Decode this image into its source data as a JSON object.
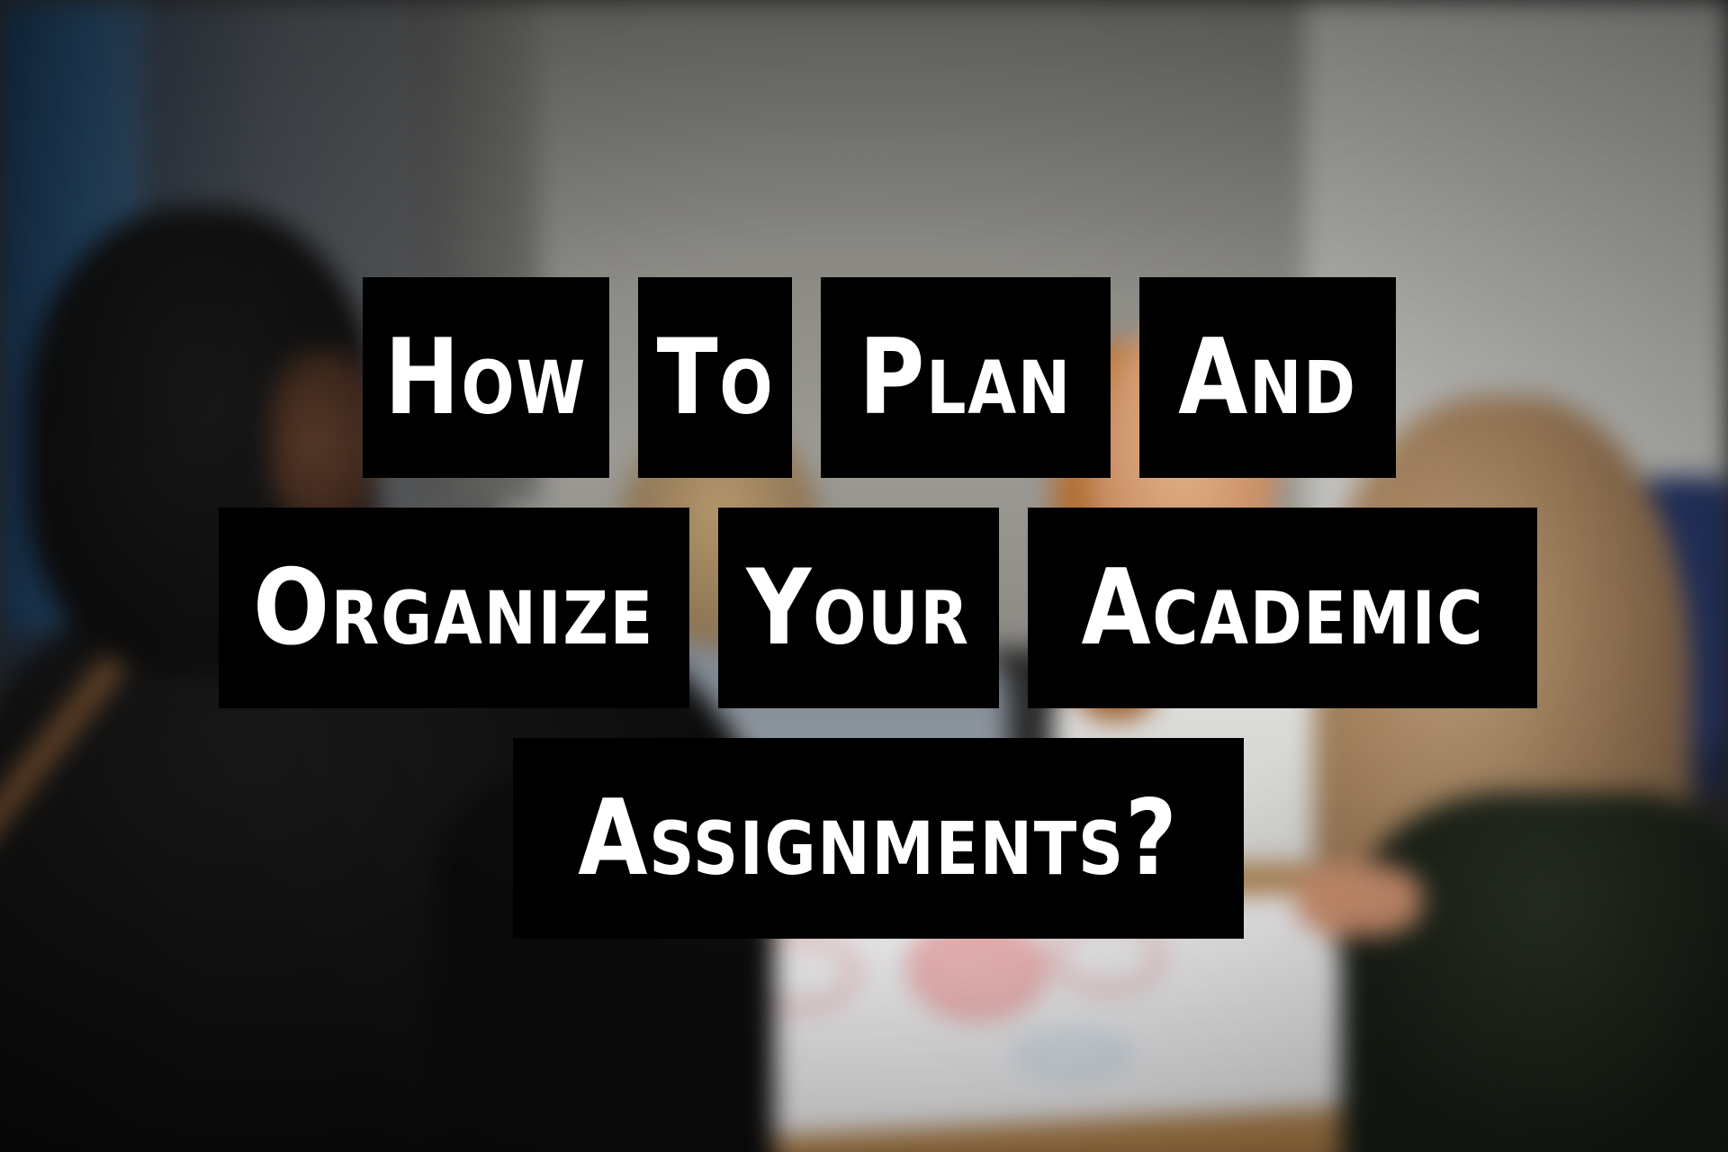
{
  "image": {
    "scene": "Blurred photo of students working around a table with a large paper sheet",
    "overlay_bg": "#000000",
    "overlay_text_color": "#ffffff"
  },
  "title": {
    "line1": [
      "How",
      "To",
      "Plan",
      "And"
    ],
    "line2": [
      "Organize",
      "Your",
      "Academic"
    ],
    "line3": [
      "Assignments?"
    ]
  }
}
